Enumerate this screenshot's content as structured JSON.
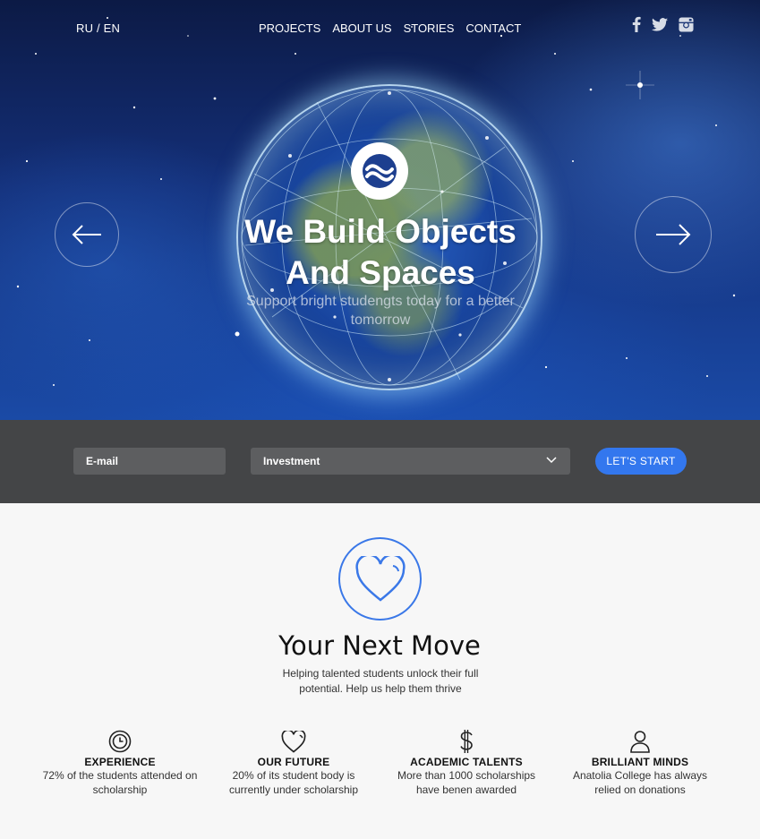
{
  "header": {
    "language": "RU / EN",
    "menu": [
      "PROJECTS",
      "ABOUT US",
      "STORIES",
      "CONTACT"
    ],
    "social_icons": [
      "facebook-icon",
      "twitter-icon",
      "instagram-icon"
    ]
  },
  "hero": {
    "title_line1": "We Build Objects",
    "title_line2": "And Spaces",
    "subtitle": "Support bright studengts today for a better tomorrow",
    "prev_icon": "arrow-left-icon",
    "next_icon": "arrow-right-icon",
    "logo_icon": "wave-logo-icon"
  },
  "form": {
    "email_placeholder": "E-mail",
    "select_value": "Investment",
    "submit_label": "LET'S START"
  },
  "intro": {
    "icon": "heart-icon",
    "title": "Your Next Move",
    "subtitle": "Helping talented students unlock their full potential. Help us help them thrive"
  },
  "features": [
    {
      "icon": "clock-icon",
      "title": "EXPERIENCE",
      "desc": "72% of the students attended on scholarship"
    },
    {
      "icon": "heart-icon",
      "title": "OUR FUTURE",
      "desc": "20% of its student body is currently under scholarship"
    },
    {
      "icon": "dollar-icon",
      "title": "ACADEMIC TALENTS",
      "desc": "More than 1000 scholarships have benen awarded"
    },
    {
      "icon": "user-icon",
      "title": "BRILLIANT MINDS",
      "desc": "Anatolia College has always relied on donations"
    }
  ],
  "colors": {
    "accent": "#3377ee",
    "form_bar": "#444547",
    "field": "#5d5e60",
    "page_bg": "#f7f7f7"
  }
}
